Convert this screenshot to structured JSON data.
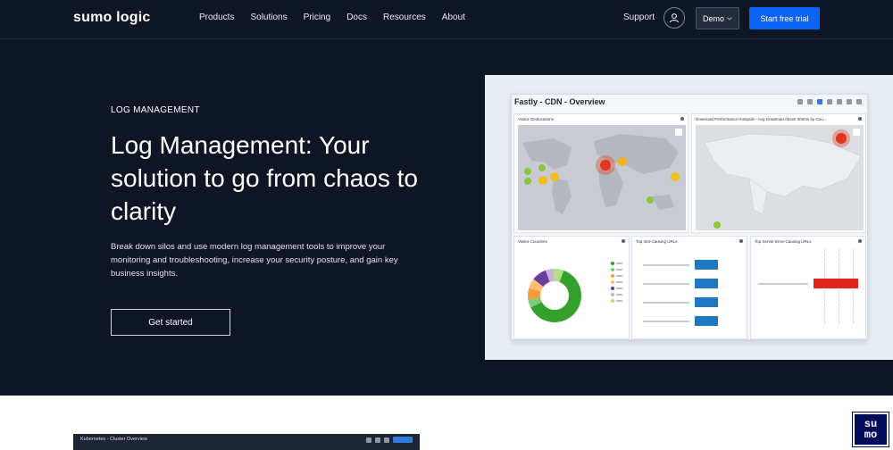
{
  "nav": {
    "logo": "sumo logic",
    "links": [
      "Products",
      "Solutions",
      "Pricing",
      "Docs",
      "Resources",
      "About"
    ],
    "support": "Support",
    "demo": "Demo",
    "trial": "Start free trial"
  },
  "hero": {
    "eyebrow": "LOG MANAGEMENT",
    "headline": "Log Management: Your solution to go from chaos to clarity",
    "description": "Break down silos and use modern log management tools to improve your monitoring and troubleshooting, increase your security posture, and gain key business insights.",
    "cta": "Get started"
  },
  "dashboard": {
    "title": "Fastly - CDN - Overview",
    "panels": {
      "geo": "Visitor Geolocations",
      "perf": "Download Performance Hotspots - Avg Download Above 300ms by Cou...",
      "countries": "Visitor Countries",
      "top404": "Top 404-Causing URLs",
      "top_errors": "Top Server Error-Causing URLs"
    },
    "colors": {
      "donut": [
        "#33a02c",
        "#7fc97f",
        "#f59d3d",
        "#fdbf6f",
        "#6a3d9a",
        "#cab2d6",
        "#b2df8a"
      ],
      "bars": "#1f78c0",
      "error_bar": "#e0261b"
    },
    "top404_values": [
      0.92,
      0.92,
      0.92,
      0.92
    ],
    "error_values": [
      0.9
    ]
  },
  "kubernetes": {
    "title": "Kubernetes - Cluster Overview"
  },
  "badge": {
    "line1": "su",
    "line2": "mo"
  }
}
